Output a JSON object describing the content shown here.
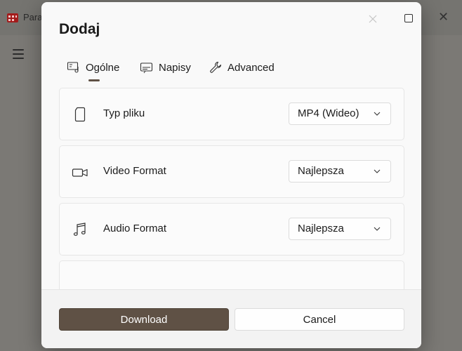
{
  "background_app": {
    "title": "Para",
    "menu_icon": "hamburger-icon"
  },
  "dialog": {
    "title": "Dodaj",
    "tabs": [
      {
        "label": "Ogólne",
        "icon": "general-settings-icon",
        "selected": true
      },
      {
        "label": "Napisy",
        "icon": "subtitles-icon",
        "selected": false
      },
      {
        "label": "Advanced",
        "icon": "wrench-icon",
        "selected": false
      }
    ],
    "settings": [
      {
        "label": "Typ pliku",
        "icon": "file-icon",
        "value": "MP4 (Wideo)"
      },
      {
        "label": "Video Format",
        "icon": "video-camera-icon",
        "value": "Najlepsza"
      },
      {
        "label": "Audio Format",
        "icon": "music-note-icon",
        "value": "Najlepsza"
      }
    ],
    "buttons": {
      "download": "Download",
      "cancel": "Cancel"
    }
  },
  "colors": {
    "accent": "#5f5145",
    "dialog_bg": "#f9f9f9",
    "card_bg": "#fbfbfb"
  }
}
